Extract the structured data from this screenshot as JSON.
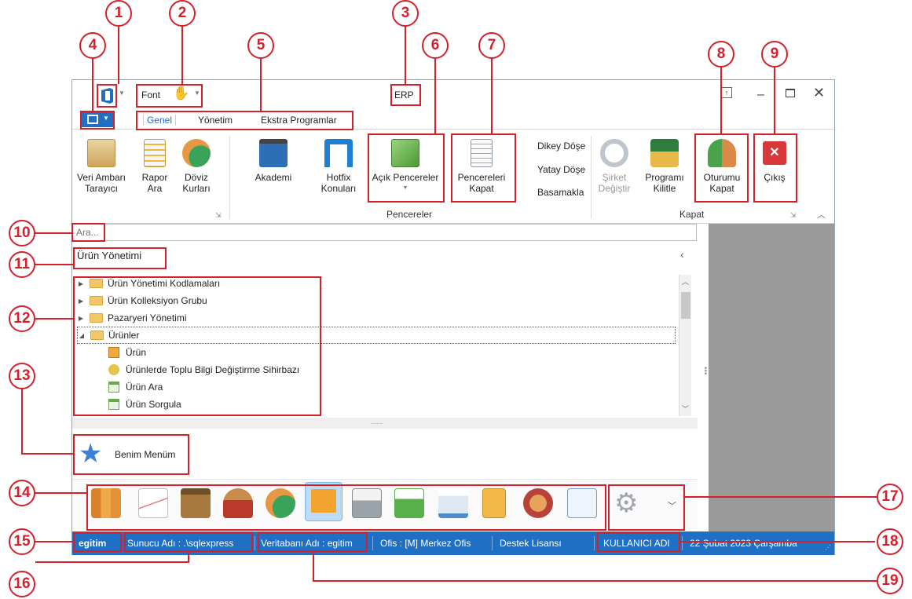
{
  "window": {
    "quick_font": "Font",
    "title": "ERP",
    "tabs": [
      "Genel",
      "Yönetim",
      "Ekstra Programlar"
    ]
  },
  "ribbon": {
    "buttons": {
      "veri_ambari": [
        "Veri Ambarı",
        "Tarayıcı"
      ],
      "rapor_ara": [
        "Rapor",
        "Ara"
      ],
      "doviz": [
        "Döviz",
        "Kurları"
      ],
      "akademi": "Akademi",
      "hotfix": [
        "Hotfix",
        "Konuları"
      ],
      "acik_pencereler": "Açık Pencereler",
      "pencereleri_kapat": [
        "Pencereleri",
        "Kapat"
      ],
      "dikey": "Dikey Döşe",
      "yatay": "Yatay Döşe",
      "basamakla": "Basamakla",
      "sirket": [
        "Şirket",
        "Değiştir"
      ],
      "programi": [
        "Programı",
        "Kilitle"
      ],
      "oturumu": [
        "Oturumu",
        "Kapat"
      ],
      "cikis": "Çıkış"
    },
    "groups": {
      "pencereler": "Pencereler",
      "kapat": "Kapat"
    }
  },
  "search": {
    "placeholder": "Ara..."
  },
  "panel": {
    "title": "Ürün Yönetimi",
    "tree": [
      "Ürün Yönetimi Kodlamaları",
      "Ürün Kolleksiyon Grubu",
      "Pazaryeri Yönetimi",
      "Ürünler",
      "Ürün",
      "Ürünlerde Toplu Bilgi Değiştirme Sihirbazı",
      "Ürün Ara",
      "Ürün Sorgula"
    ],
    "splitter": "......",
    "favorites": "Benim Menüm"
  },
  "status_bar": {
    "user_short": "egitim",
    "server": "Sunucu Adı : .\\sqlexpress",
    "database": "Veritabanı Adı : egitim",
    "office": "Ofis : [M]  Merkez Ofis",
    "license": "Destek Lisansı",
    "user": "KULLANICI ADI",
    "date": "22 Şubat 2023 Çarşamba"
  },
  "callouts": [
    "1",
    "2",
    "3",
    "4",
    "5",
    "6",
    "7",
    "8",
    "9",
    "10",
    "11",
    "12",
    "13",
    "14",
    "15",
    "16",
    "17",
    "18",
    "19"
  ],
  "colors": {
    "accent": "#1f6fc5",
    "callout": "#d4202a",
    "side_panel": "#9a9a9a"
  }
}
